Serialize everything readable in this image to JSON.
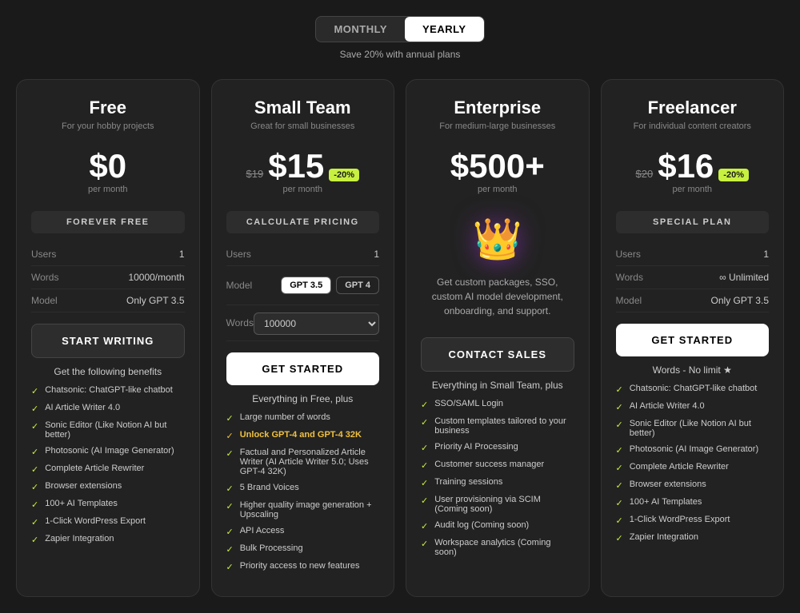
{
  "billing": {
    "toggle_monthly": "MONTHLY",
    "toggle_yearly": "YEARLY",
    "toggle_active": "yearly",
    "save_text": "Save 20% with annual plans"
  },
  "plans": [
    {
      "id": "free",
      "name": "Free",
      "desc": "For your hobby projects",
      "price_original": null,
      "price_main": "$0",
      "price_badge": null,
      "price_period": "per month",
      "label": "FOREVER FREE",
      "users": "1",
      "words": "10000/month",
      "model": "Only GPT 3.5",
      "cta": "START WRITING",
      "cta_style": "dark",
      "benefits_title": "Get the following benefits",
      "benefits": [
        "Chatsonic: ChatGPT-like chatbot",
        "AI Article Writer 4.0",
        "Sonic Editor (Like Notion AI but better)",
        "Photosonic (AI Image Generator)",
        "Complete Article Rewriter",
        "Browser extensions",
        "100+ AI Templates",
        "1-Click WordPress Export",
        "Zapier Integration"
      ]
    },
    {
      "id": "small-team",
      "name": "Small Team",
      "desc": "Great for small businesses",
      "price_original": "$19",
      "price_main": "$15",
      "price_badge": "-20%",
      "price_period": "per month",
      "label": "CALCULATE PRICING",
      "users": "1",
      "model_options": [
        "GPT 3.5",
        "GPT 4"
      ],
      "words_options": [
        "100000"
      ],
      "cta": "GET STARTED",
      "cta_style": "white",
      "benefits_title": "Everything in Free, plus",
      "benefits": [
        {
          "text": "Large number of words",
          "highlight": false
        },
        {
          "text": "Unlock GPT-4 and GPT-4 32K",
          "highlight": true
        },
        {
          "text": "Factual and Personalized Article Writer (AI Article Writer 5.0; Uses GPT-4 32K)",
          "highlight": false
        },
        {
          "text": "5 Brand Voices",
          "highlight": false
        },
        {
          "text": "Higher quality image generation + Upscaling",
          "highlight": false
        },
        {
          "text": "API Access",
          "highlight": false
        },
        {
          "text": "Bulk Processing",
          "highlight": false
        },
        {
          "text": "Priority access to new features",
          "highlight": false
        }
      ]
    },
    {
      "id": "enterprise",
      "name": "Enterprise",
      "desc": "For medium-large businesses",
      "price_main": "$500+",
      "price_period": "per month",
      "label": null,
      "enterprise_text": "Get custom packages, SSO, custom AI model development, onboarding, and support.",
      "cta": "CONTACT SALES",
      "cta_style": "dark",
      "benefits_title": "Everything in Small Team, plus",
      "benefits": [
        "SSO/SAML Login",
        "Custom templates tailored to your business",
        "Priority AI Processing",
        "Customer success manager",
        "Training sessions",
        "User provisioning via SCIM (Coming soon)",
        "Audit log (Coming soon)",
        "Workspace analytics (Coming soon)"
      ]
    },
    {
      "id": "freelancer",
      "name": "Freelancer",
      "desc": "For individual content creators",
      "price_original": "$20",
      "price_main": "$16",
      "price_badge": "-20%",
      "price_period": "per month",
      "label": "SPECIAL PLAN",
      "users": "1",
      "words": "∞ Unlimited",
      "model": "Only GPT 3.5",
      "cta": "GET STARTED",
      "cta_style": "white",
      "benefits_title": "Words - No limit ★",
      "benefits": [
        "Chatsonic: ChatGPT-like chatbot",
        "AI Article Writer 4.0",
        "Sonic Editor (Like Notion AI but better)",
        "Photosonic (AI Image Generator)",
        "Complete Article Rewriter",
        "Browser extensions",
        "100+ AI Templates",
        "1-Click WordPress Export",
        "Zapier Integration"
      ]
    }
  ]
}
